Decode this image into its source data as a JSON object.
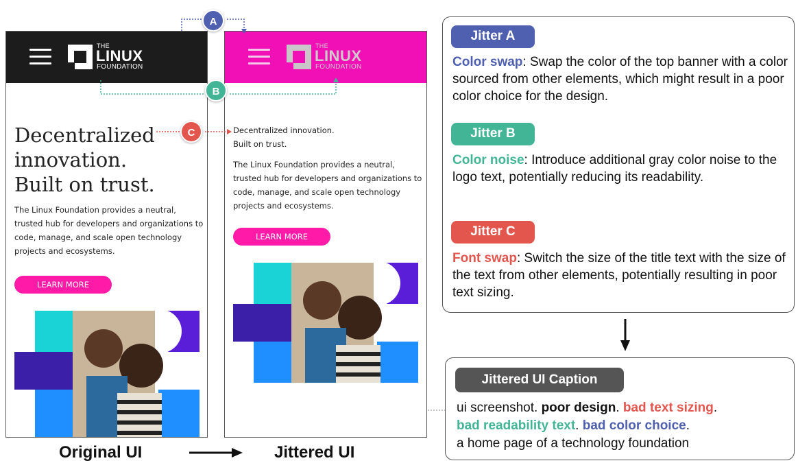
{
  "original_ui": {
    "logo": {
      "the": "THE",
      "linux": "LINUX",
      "foundation": "FOUNDATION"
    },
    "title": "Decentralized innovation. Built on trust.",
    "title_lines": [
      "Decentralized",
      "innovation.",
      "Built on trust."
    ],
    "body": "The Linux Foundation provides a neutral, trusted hub for developers and organizations to code, manage, and scale open technology projects and ecosystems.",
    "button": "LEARN MORE",
    "banner_color": "#1c1c1c"
  },
  "jittered_ui": {
    "logo": {
      "the": "THE",
      "linux": "LINUX",
      "foundation": "FOUNDATION"
    },
    "title_lines": [
      "Decentralized innovation.",
      "Built on trust."
    ],
    "body": "The Linux Foundation provides a neutral, trusted hub for developers and organizations to code, manage, and scale open technology projects and ecosystems.",
    "button": "LEARN MORE",
    "banner_color": "#f010b6"
  },
  "badges": {
    "a": "A",
    "b": "B",
    "c": "C"
  },
  "labels": {
    "original": "Original UI",
    "jittered": "Jittered UI"
  },
  "jitters": {
    "a": {
      "title": "Jitter A",
      "keyword": "Color swap",
      "text": ": Swap the color of the top banner with a color sourced from other elements, which might result in a poor color choice for the design."
    },
    "b": {
      "title": "Jitter B",
      "keyword": "Color noise",
      "text": ": Introduce additional gray color noise to the logo text, potentially reducing its readability."
    },
    "c": {
      "title": "Jitter C",
      "keyword": "Font swap",
      "text": ": Switch the size of the title text with the size of the text from other elements, potentially resulting in poor text sizing."
    }
  },
  "caption": {
    "title": "Jittered UI Caption",
    "part1": "ui screenshot. ",
    "poor_design": "poor design",
    "sep1": ". ",
    "bad_text_sizing": "bad text sizing",
    "sep2": ".",
    "bad_readability": "bad readability text",
    "sep3": ". ",
    "bad_color": "bad color choice",
    "sep4": ".",
    "description": "a home page of a technology foundation"
  },
  "colors": {
    "jitter_a": "#5060b0",
    "jitter_b": "#43b597",
    "jitter_c": "#e2564e",
    "learn_more": "#ff1aa8"
  }
}
